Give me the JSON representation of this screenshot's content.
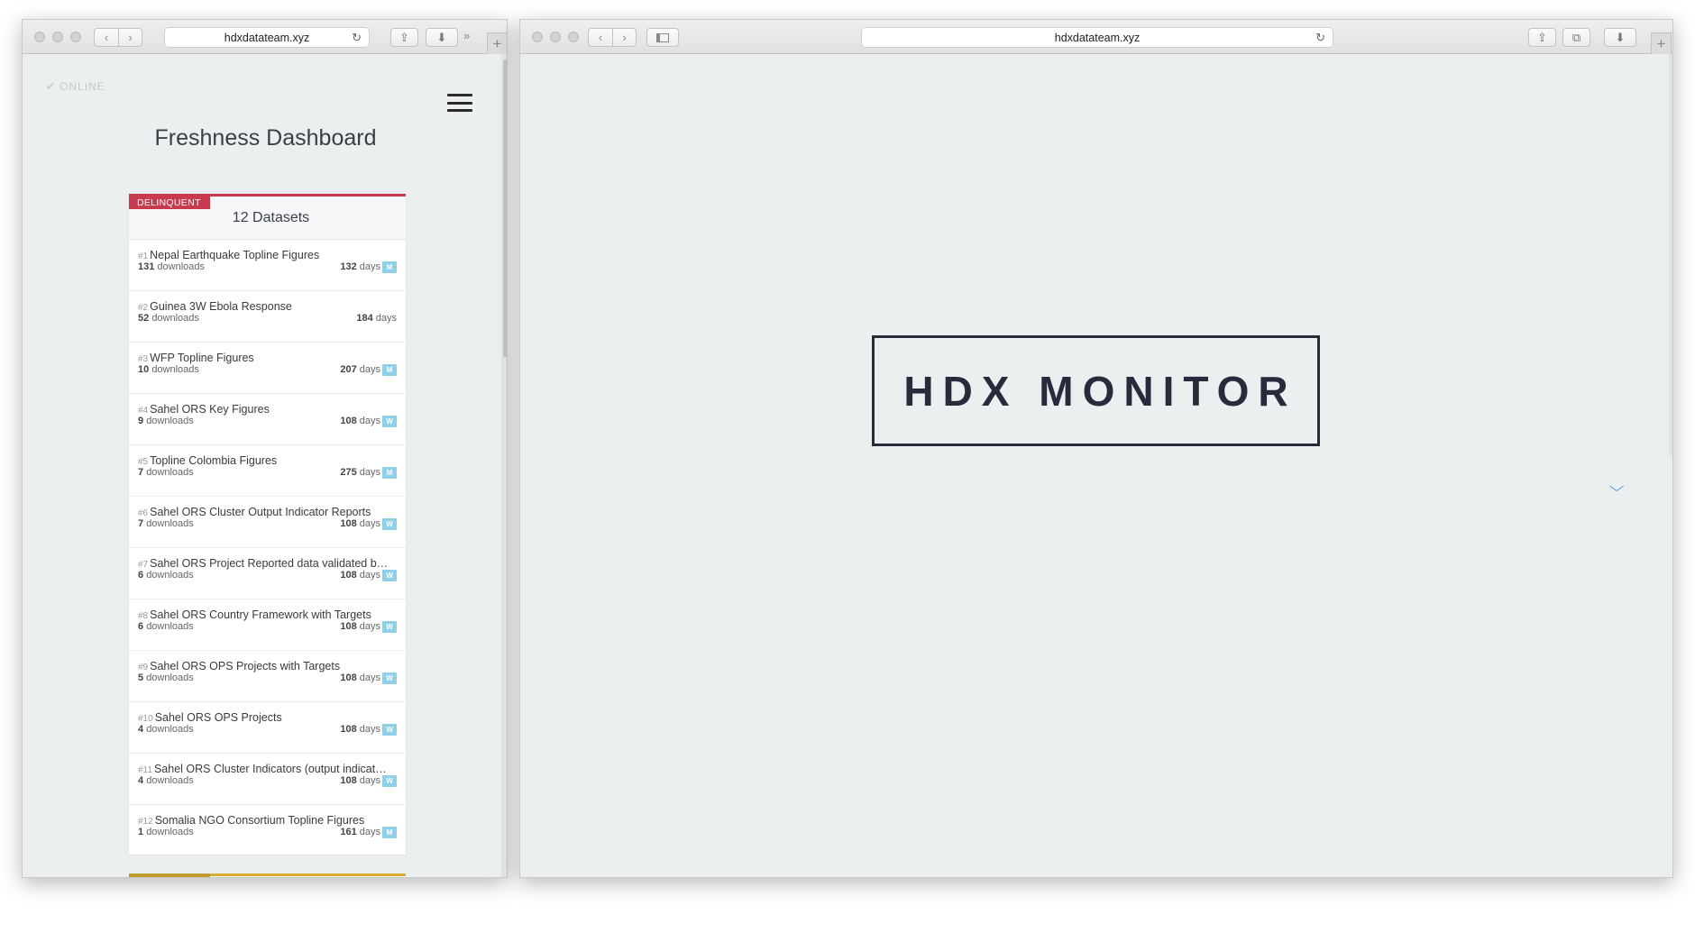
{
  "left_window": {
    "url": "hdxdatateam.xyz",
    "status": "ONLINE",
    "title": "Freshness Dashboard",
    "card": {
      "badge": "DELINQUENT",
      "count_label": "12 Datasets",
      "items": [
        {
          "rank": "#1",
          "title": "Nepal Earthquake Topline Figures",
          "downloads": "131",
          "days": "132",
          "badge": "M"
        },
        {
          "rank": "#2",
          "title": "Guinea 3W Ebola Response",
          "downloads": "52",
          "days": "184",
          "badge": ""
        },
        {
          "rank": "#3",
          "title": "WFP Topline Figures",
          "downloads": "10",
          "days": "207",
          "badge": "M"
        },
        {
          "rank": "#4",
          "title": "Sahel ORS Key Figures",
          "downloads": "9",
          "days": "108",
          "badge": "W"
        },
        {
          "rank": "#5",
          "title": "Topline Colombia Figures",
          "downloads": "7",
          "days": "275",
          "badge": "M"
        },
        {
          "rank": "#6",
          "title": "Sahel ORS Cluster Output Indicator Reports",
          "downloads": "7",
          "days": "108",
          "badge": "W"
        },
        {
          "rank": "#7",
          "title": "Sahel ORS Project Reported data validated by cluster",
          "downloads": "6",
          "days": "108",
          "badge": "W"
        },
        {
          "rank": "#8",
          "title": "Sahel ORS Country Framework with Targets",
          "downloads": "6",
          "days": "108",
          "badge": "W"
        },
        {
          "rank": "#9",
          "title": "Sahel ORS OPS Projects with Targets",
          "downloads": "5",
          "days": "108",
          "badge": "W"
        },
        {
          "rank": "#10",
          "title": "Sahel ORS OPS Projects",
          "downloads": "4",
          "days": "108",
          "badge": "W"
        },
        {
          "rank": "#11",
          "title": "Sahel ORS Cluster Indicators (output indicators)",
          "downloads": "4",
          "days": "108",
          "badge": "W"
        },
        {
          "rank": "#12",
          "title": "Somalia NGO Consortium Topline Figures",
          "downloads": "1",
          "days": "161",
          "badge": "M"
        }
      ],
      "downloads_suffix": "downloads",
      "days_suffix": "days"
    }
  },
  "right_window": {
    "url": "hdxdatateam.xyz",
    "logo_text": "HDX MONITOR"
  },
  "icons": {
    "back": "chevron-left-icon",
    "forward": "chevron-right-icon",
    "reload": "reload-icon",
    "share": "share-icon",
    "download": "download-icon",
    "sidebar": "sidebar-icon",
    "tabs": "tabs-icon",
    "overflow": "overflow-icon",
    "menu": "hamburger-menu-icon",
    "scroll_down": "chevron-down-icon"
  },
  "colors": {
    "delinquent": "#c83a4e",
    "badge": "#8fd0e6",
    "logo": "#262c3c",
    "accent_link": "#3a8fd0",
    "next_card": "#d8ab33"
  }
}
